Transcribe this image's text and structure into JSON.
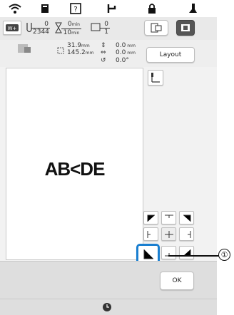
{
  "info": {
    "stitch_count": "0",
    "stitch_total": "2344",
    "time_elapsed": "0",
    "time_elapsed_unit": "min",
    "time_total": "10",
    "time_total_unit": "min",
    "color_current": "0",
    "color_total": "1"
  },
  "dimensions": {
    "width": "31.9",
    "height": "145.2",
    "unit": "mm",
    "offset_v": "0.0",
    "offset_h": "0.0",
    "rotation": "0.0°"
  },
  "layout_button": "Layout",
  "design_text": "AB<DE",
  "ok_button": "OK",
  "callout_number": "①",
  "colors": {
    "selected_border": "#1a7fd0",
    "panel": "#f2f2f2"
  }
}
